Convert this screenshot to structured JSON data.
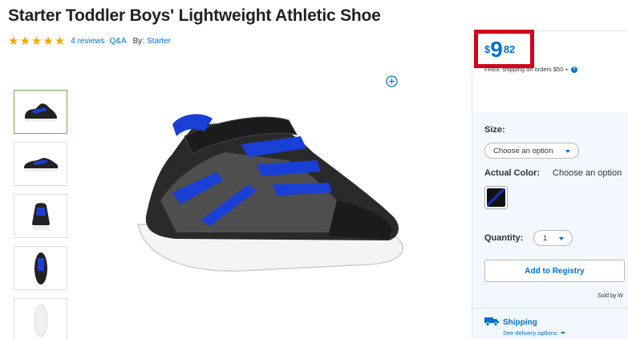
{
  "product": {
    "title": "Starter Toddler Boys' Lightweight Athletic Shoe",
    "rating_stars": 5,
    "reviews": "4 reviews",
    "qa": "Q&A",
    "by_label": "By:",
    "brand": "Starter"
  },
  "price": {
    "currency": "$",
    "whole": "9",
    "cents": "82",
    "shipping_note": "FREE shipping on orders $50 +"
  },
  "options": {
    "size_label": "Size:",
    "size_value": "Choose an option",
    "color_label": "Actual Color:",
    "color_value": "Choose an option",
    "quantity_label": "Quantity:",
    "quantity_value": "1"
  },
  "actions": {
    "registry": "Add to Registry",
    "sold_by": "Sold by W"
  },
  "shipping": {
    "title": "Shipping",
    "link": "See delivery options"
  },
  "colors": {
    "accent": "#0071ce",
    "highlight_border": "#d0021b",
    "star": "#f7a600",
    "panel_bg": "#f2f8fd"
  },
  "icons": [
    "star-icon",
    "zoom-plus-icon",
    "help-icon",
    "caret-down-icon",
    "truck-icon"
  ]
}
